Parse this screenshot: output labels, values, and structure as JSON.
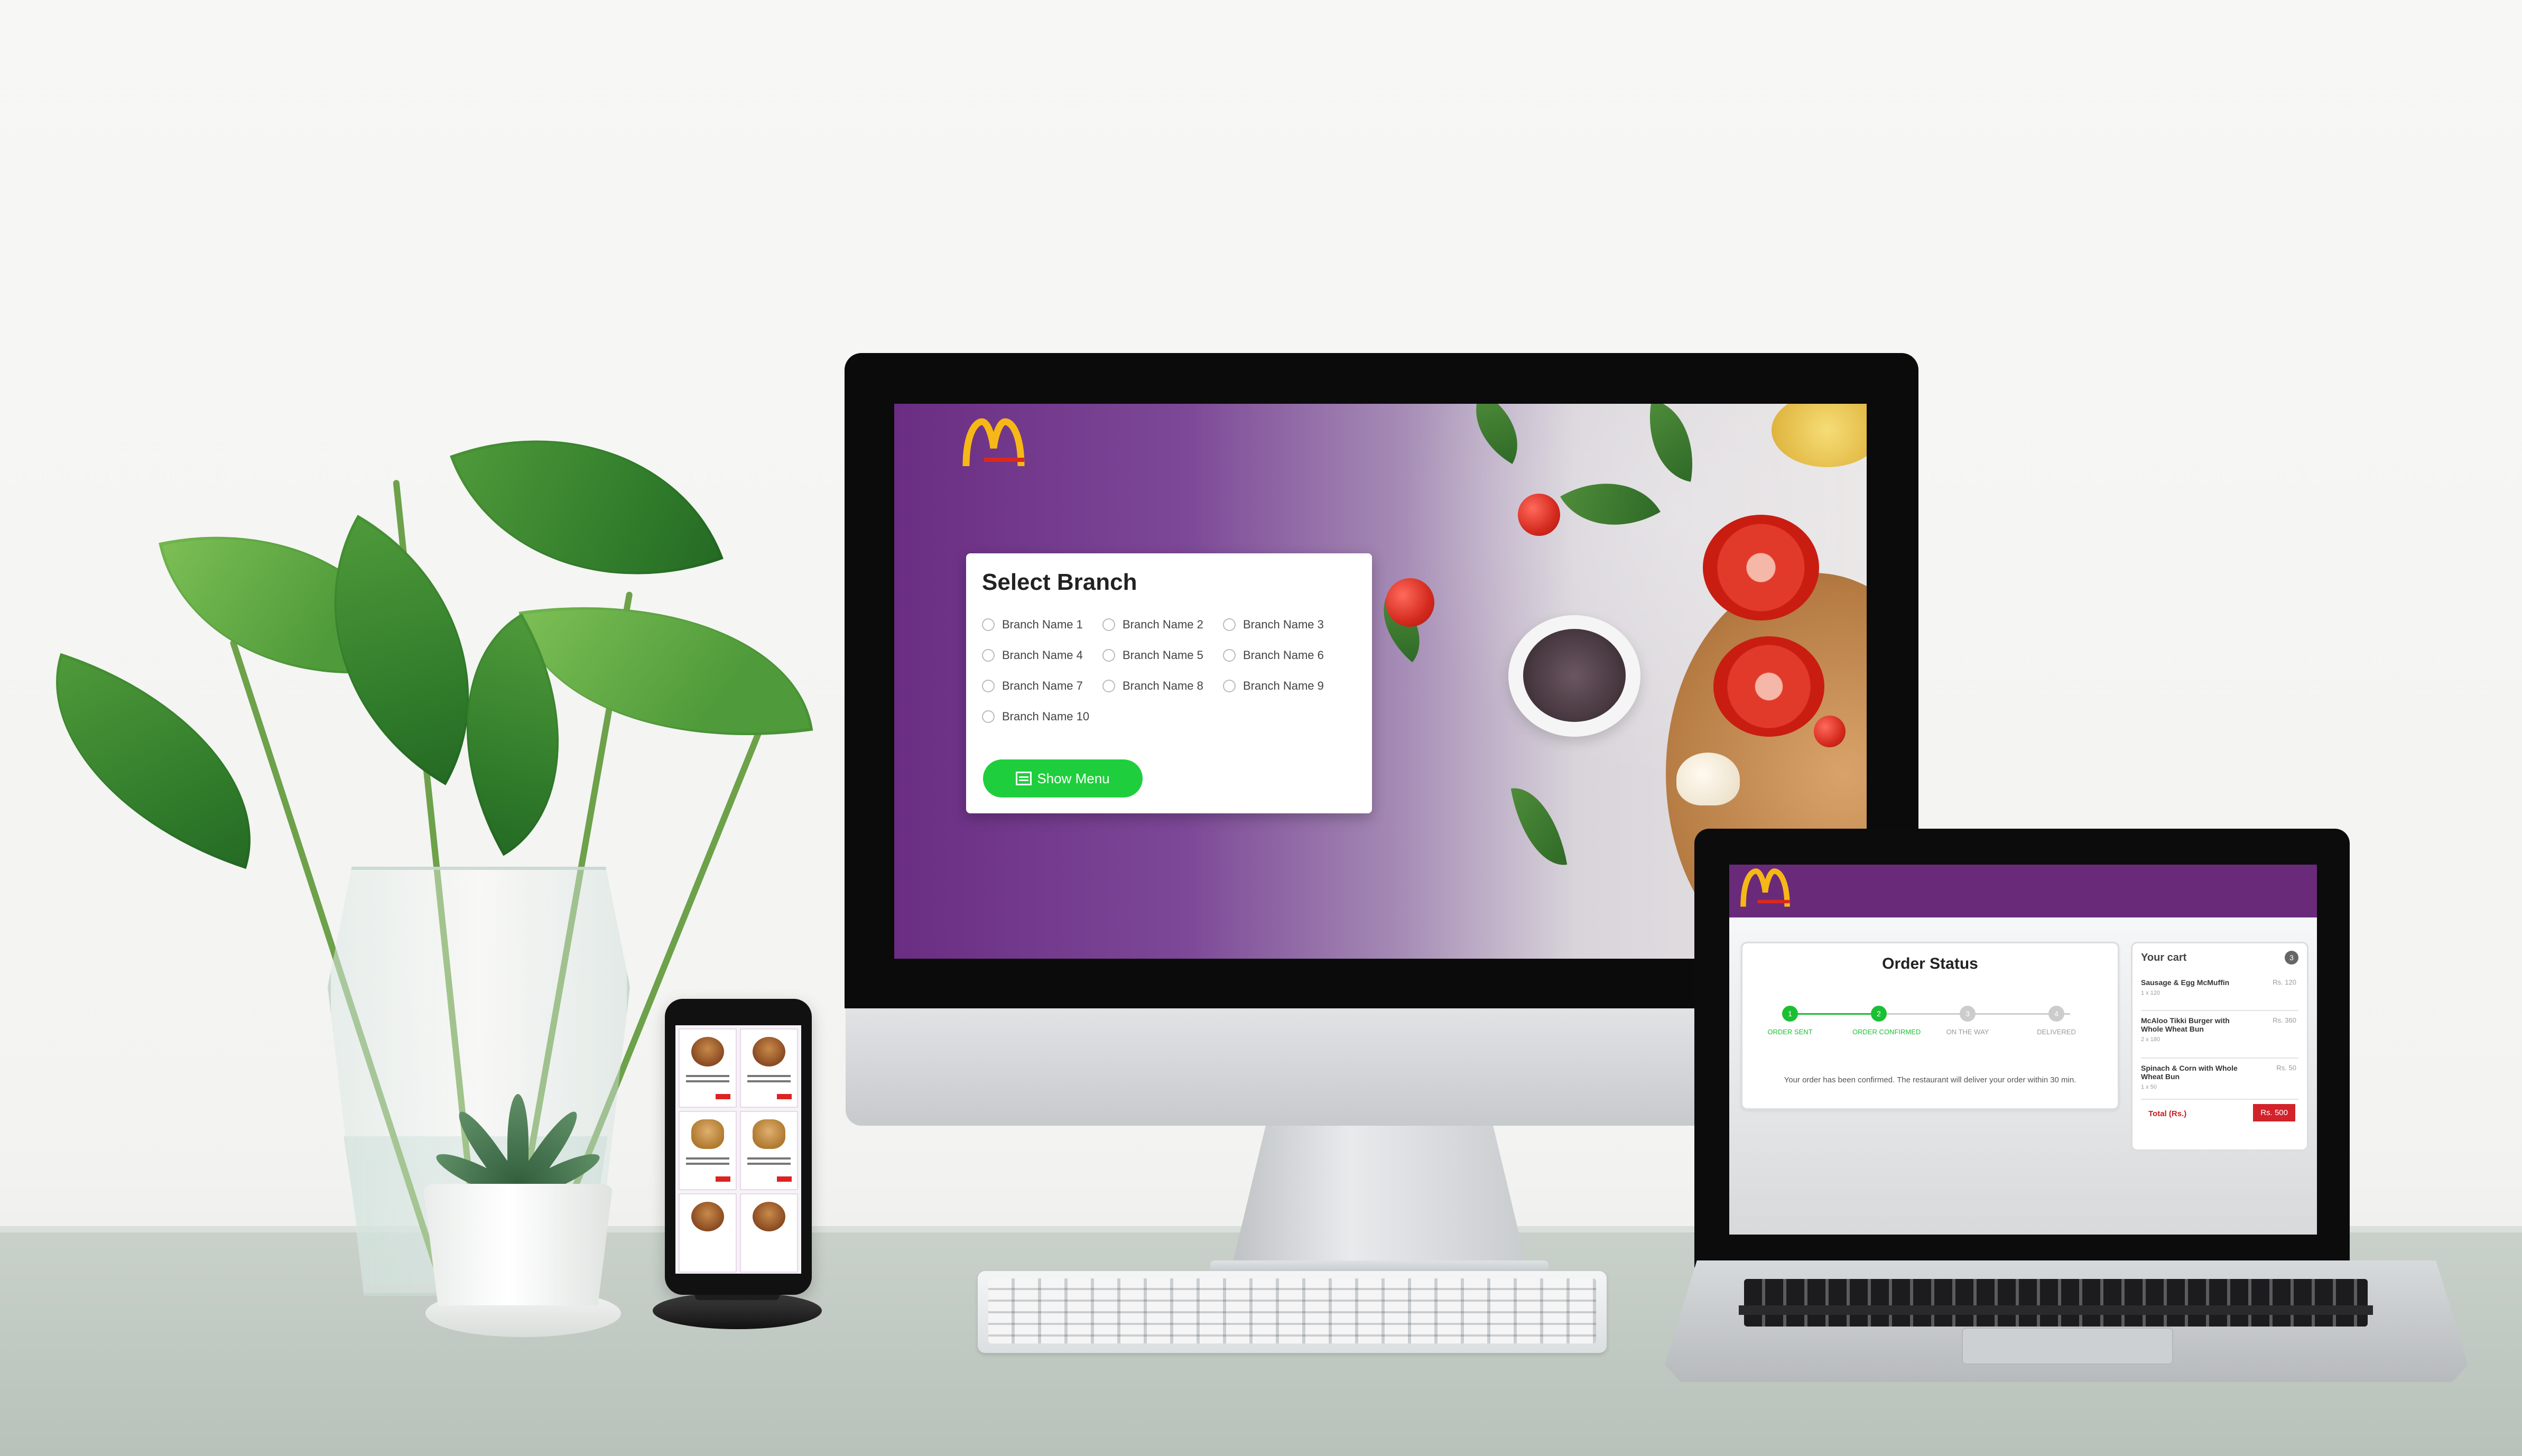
{
  "imac": {
    "logo": "mcdonalds-logo",
    "branch": {
      "title": "Select Branch",
      "options": [
        "Branch Name 1",
        "Branch Name 2",
        "Branch Name 3",
        "Branch Name 4",
        "Branch Name 5",
        "Branch Name 6",
        "Branch Name 7",
        "Branch Name 8",
        "Branch Name 9",
        "Branch Name 10"
      ],
      "button_label": "Show Menu",
      "button_icon": "menu-list-icon"
    },
    "colors": {
      "purple": "#6a2d83",
      "green": "#1fce3c",
      "logo_yellow": "#f6b817",
      "logo_red": "#da291c"
    }
  },
  "laptop": {
    "order_status": {
      "title": "Order Status",
      "steps": [
        {
          "num": "1",
          "label": "ORDER SENT",
          "done": true
        },
        {
          "num": "2",
          "label": "ORDER CONFIRMED",
          "done": true
        },
        {
          "num": "3",
          "label": "ON THE WAY",
          "done": false
        },
        {
          "num": "4",
          "label": "DELIVERED",
          "done": false
        }
      ],
      "message": "Your order has been confirmed. The restaurant will deliver your order within 30 min."
    },
    "cart": {
      "title": "Your cart",
      "count": "3",
      "items": [
        {
          "name": "Sausage & Egg McMuffin",
          "qty": "1 x 120",
          "price": "Rs. 120"
        },
        {
          "name": "McAloo Tikki Burger with Whole Wheat Bun",
          "qty": "2 x 180",
          "price": "Rs. 360"
        },
        {
          "name": "Spinach & Corn with Whole Wheat Bun",
          "qty": "1 x 50",
          "price": "Rs. 50"
        }
      ],
      "total_label": "Total (Rs.)",
      "total_value": "Rs. 500"
    }
  },
  "phone": {
    "cards": 6
  }
}
